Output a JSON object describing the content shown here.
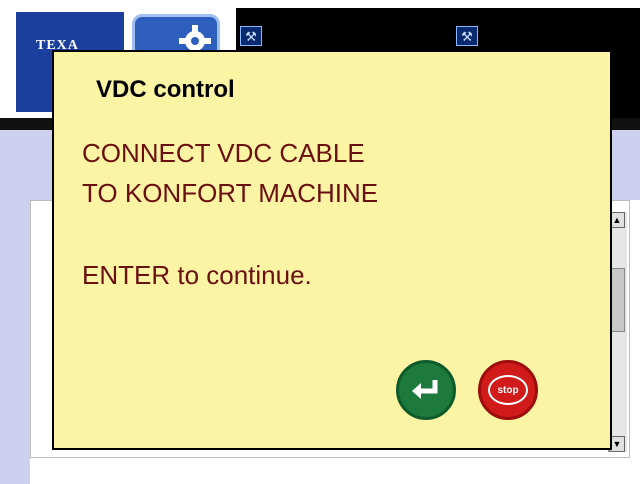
{
  "header": {
    "logo_text": "TEXA",
    "settings_icon": "gear-wrench-icon",
    "tool_icons": [
      "car-service-icon",
      "car-service-icon"
    ]
  },
  "dialog": {
    "title": "VDC control",
    "line1": "CONNECT VDC CABLE",
    "line2": "TO KONFORT MACHINE",
    "line3": "ENTER to continue.",
    "stop_label": "stop"
  },
  "colors": {
    "dialog_bg": "#fbf4a5",
    "message_text": "#6a1010",
    "enter_button": "#1b7a3c",
    "stop_button": "#d11a1a",
    "brand_blue": "#1a3f9c"
  }
}
